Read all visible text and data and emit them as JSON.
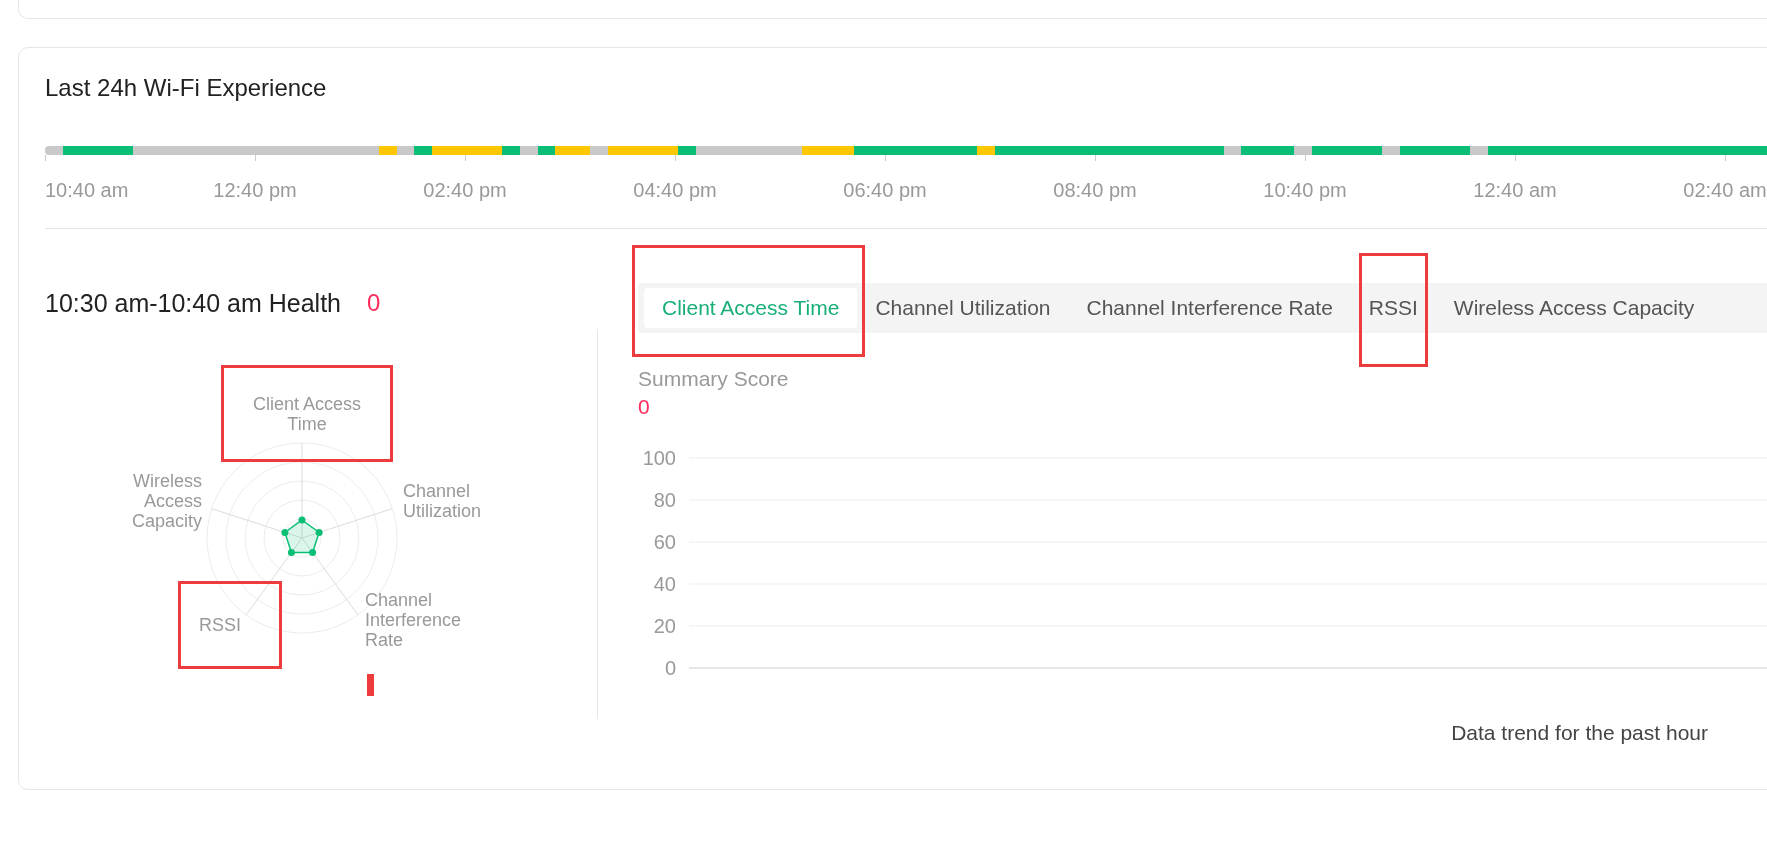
{
  "experience": {
    "title": "Last 24h Wi-Fi Experience",
    "slots": [
      {
        "color": "#c9c9c9"
      },
      {
        "color": "#0abf75"
      },
      {
        "color": "#0abf75"
      },
      {
        "color": "#0abf75"
      },
      {
        "color": "#0abf75"
      },
      {
        "color": "#c9c9c9"
      },
      {
        "color": "#c9c9c9"
      },
      {
        "color": "#c9c9c9"
      },
      {
        "color": "#c9c9c9"
      },
      {
        "color": "#c9c9c9"
      },
      {
        "color": "#c9c9c9"
      },
      {
        "color": "#c9c9c9"
      },
      {
        "color": "#c9c9c9"
      },
      {
        "color": "#c9c9c9"
      },
      {
        "color": "#c9c9c9"
      },
      {
        "color": "#c9c9c9"
      },
      {
        "color": "#c9c9c9"
      },
      {
        "color": "#c9c9c9"
      },
      {
        "color": "#c9c9c9"
      },
      {
        "color": "#ffc700"
      },
      {
        "color": "#c9c9c9"
      },
      {
        "color": "#0abf75"
      },
      {
        "color": "#ffc700"
      },
      {
        "color": "#ffc700"
      },
      {
        "color": "#ffc700"
      },
      {
        "color": "#ffc700"
      },
      {
        "color": "#0abf75"
      },
      {
        "color": "#c9c9c9"
      },
      {
        "color": "#0abf75"
      },
      {
        "color": "#ffc700"
      },
      {
        "color": "#ffc700"
      },
      {
        "color": "#c9c9c9"
      },
      {
        "color": "#ffc700"
      },
      {
        "color": "#ffc700"
      },
      {
        "color": "#ffc700"
      },
      {
        "color": "#ffc700"
      },
      {
        "color": "#0abf75"
      },
      {
        "color": "#c9c9c9"
      },
      {
        "color": "#c9c9c9"
      },
      {
        "color": "#c9c9c9"
      },
      {
        "color": "#c9c9c9"
      },
      {
        "color": "#c9c9c9"
      },
      {
        "color": "#c9c9c9"
      },
      {
        "color": "#ffc700"
      },
      {
        "color": "#ffc700"
      },
      {
        "color": "#ffc700"
      },
      {
        "color": "#0abf75"
      },
      {
        "color": "#0abf75"
      },
      {
        "color": "#0abf75"
      },
      {
        "color": "#0abf75"
      },
      {
        "color": "#0abf75"
      },
      {
        "color": "#0abf75"
      },
      {
        "color": "#0abf75"
      },
      {
        "color": "#ffc700"
      },
      {
        "color": "#0abf75"
      },
      {
        "color": "#0abf75"
      },
      {
        "color": "#0abf75"
      },
      {
        "color": "#0abf75"
      },
      {
        "color": "#0abf75"
      },
      {
        "color": "#0abf75"
      },
      {
        "color": "#0abf75"
      },
      {
        "color": "#0abf75"
      },
      {
        "color": "#0abf75"
      },
      {
        "color": "#0abf75"
      },
      {
        "color": "#0abf75"
      },
      {
        "color": "#0abf75"
      },
      {
        "color": "#0abf75"
      },
      {
        "color": "#c9c9c9"
      },
      {
        "color": "#0abf75"
      },
      {
        "color": "#0abf75"
      },
      {
        "color": "#0abf75"
      },
      {
        "color": "#c9c9c9"
      },
      {
        "color": "#0abf75"
      },
      {
        "color": "#0abf75"
      },
      {
        "color": "#0abf75"
      },
      {
        "color": "#0abf75"
      },
      {
        "color": "#c9c9c9"
      },
      {
        "color": "#0abf75"
      },
      {
        "color": "#0abf75"
      },
      {
        "color": "#0abf75"
      },
      {
        "color": "#0abf75"
      },
      {
        "color": "#c9c9c9"
      },
      {
        "color": "#0abf75"
      },
      {
        "color": "#0abf75"
      },
      {
        "color": "#0abf75"
      },
      {
        "color": "#0abf75"
      },
      {
        "color": "#0abf75"
      },
      {
        "color": "#0abf75"
      },
      {
        "color": "#0abf75"
      },
      {
        "color": "#0abf75"
      },
      {
        "color": "#0abf75"
      },
      {
        "color": "#0abf75"
      },
      {
        "color": "#0abf75"
      },
      {
        "color": "#0abf75"
      },
      {
        "color": "#0abf75"
      },
      {
        "color": "#0abf75"
      },
      {
        "color": "#0abf75"
      },
      {
        "color": "#0abf75"
      }
    ],
    "time_labels": [
      "10:40 am",
      "12:40 pm",
      "02:40 pm",
      "04:40 pm",
      "06:40 pm",
      "08:40 pm",
      "10:40 pm",
      "12:40 am",
      "02:40 am"
    ]
  },
  "health": {
    "title": "10:30 am-10:40 am Health",
    "score": "0",
    "radar_axes": [
      {
        "label": "Client Access Time",
        "kind": "top",
        "highlighted": true
      },
      {
        "label": "Wireless Access Capacity",
        "kind": "upperleft",
        "highlighted": false
      },
      {
        "label": "Channel Utilization",
        "kind": "upperright",
        "highlighted": false
      },
      {
        "label": "RSSI",
        "kind": "lowerleft",
        "highlighted": true
      },
      {
        "label": "Channel Interference Rate",
        "kind": "lowerright",
        "highlighted": false
      }
    ]
  },
  "tabs": [
    {
      "label": "Client Access Time",
      "selected": true,
      "highlighted": true
    },
    {
      "label": "Channel Utilization",
      "selected": false,
      "highlighted": false
    },
    {
      "label": "Channel Interference Rate",
      "selected": false,
      "highlighted": false
    },
    {
      "label": "RSSI",
      "selected": false,
      "highlighted": true
    },
    {
      "label": "Wireless Access Capacity",
      "selected": false,
      "highlighted": false
    }
  ],
  "summary": {
    "label": "Summary Score",
    "score": "0"
  },
  "trend": {
    "y_labels": [
      "100",
      "80",
      "60",
      "40",
      "20",
      "0"
    ],
    "caption": "Data trend for the past hour"
  }
}
